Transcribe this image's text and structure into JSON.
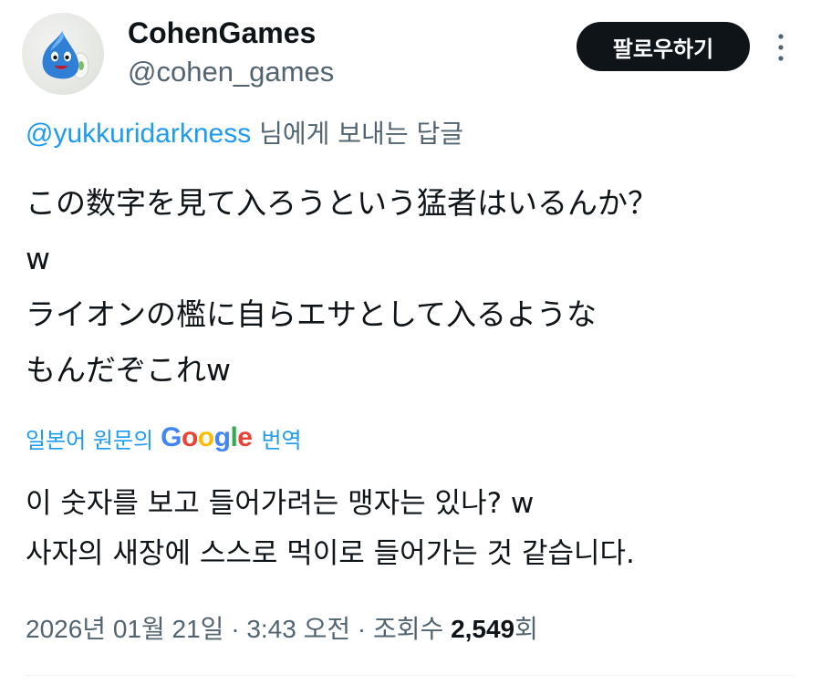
{
  "author": {
    "display_name": "CohenGames",
    "handle": "@cohen_games",
    "avatar_icon": "blue-slime-avatar"
  },
  "actions": {
    "follow_label": "팔로우하기",
    "more_icon": "more-vertical-icon"
  },
  "reply": {
    "mention": "@yukkuridarkness",
    "suffix": " 님에게 보내는 답글"
  },
  "tweet": {
    "lines": [
      "この数字を見て入ろうという猛者はいるんか？",
      "w",
      "ライオンの檻に自らエサとして入るような",
      "もんだぞこれw"
    ]
  },
  "translation": {
    "prefix": "일본어 원문의",
    "logo_letters": [
      "G",
      "o",
      "o",
      "g",
      "l",
      "e"
    ],
    "suffix": "번역",
    "lines": [
      "이 숫자를 보고 들어가려는 맹자는 있나? w",
      "사자의 새장에 스스로 먹이로 들어가는 것 같습니다."
    ]
  },
  "meta": {
    "date": "2026년 01월 21일",
    "sep1": " · ",
    "time": "3:43 오전",
    "sep2": " · ",
    "views_label": "조회수 ",
    "views_count": "2,549",
    "views_suffix": "회"
  },
  "colors": {
    "link": "#1d9bf0",
    "secondary_text": "#536471",
    "primary_text": "#0f1419",
    "follow_bg": "#0f1419"
  }
}
